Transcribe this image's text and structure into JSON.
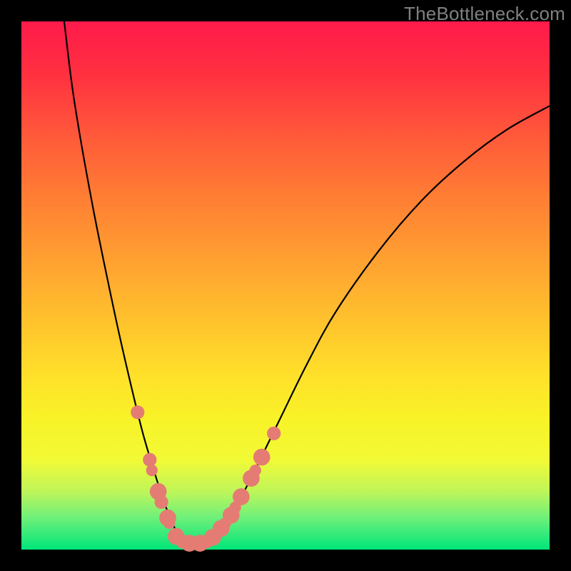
{
  "watermark": "TheBottleneck.com",
  "colors": {
    "frame_background": "#000000",
    "gradient_top": "#ff1a4b",
    "gradient_bottom": "#00e57a",
    "curve_stroke": "#000000",
    "marker_fill": "#e47c74",
    "watermark_color": "#808080"
  },
  "chart_data": {
    "type": "line",
    "title": "",
    "xlabel": "",
    "ylabel": "",
    "xlim": [
      0,
      100
    ],
    "ylim": [
      0,
      100
    ],
    "grid": false,
    "legend": false,
    "series": [
      {
        "name": "curve",
        "x": [
          8.1,
          10,
          13.5,
          17.6,
          20.3,
          23.0,
          25.7,
          27.0,
          28.4,
          29.7,
          32.4,
          35.1,
          37.8,
          40.5,
          43.2,
          48.6,
          54.0,
          59.5,
          67.6,
          75.7,
          83.8,
          91.9,
          100.0
        ],
        "y": [
          100,
          85,
          65.0,
          45.0,
          33.0,
          22.0,
          13.0,
          9.0,
          5.5,
          3.0,
          1.0,
          1.5,
          4.0,
          8.0,
          13.0,
          24.0,
          35.0,
          45.0,
          56.5,
          66.0,
          73.5,
          79.5,
          84.0
        ]
      }
    ],
    "markers": {
      "name": "highlight-markers",
      "points": [
        {
          "x": 22.0,
          "y": 26.0,
          "r": 1.3
        },
        {
          "x": 24.3,
          "y": 17.0,
          "r": 1.3
        },
        {
          "x": 24.7,
          "y": 15.0,
          "r": 1.1
        },
        {
          "x": 25.9,
          "y": 11.0,
          "r": 1.6
        },
        {
          "x": 26.5,
          "y": 9.0,
          "r": 1.3
        },
        {
          "x": 27.7,
          "y": 6.0,
          "r": 1.6
        },
        {
          "x": 28.0,
          "y": 5.0,
          "r": 1.1
        },
        {
          "x": 29.3,
          "y": 2.5,
          "r": 1.6
        },
        {
          "x": 30.5,
          "y": 1.5,
          "r": 1.3
        },
        {
          "x": 31.8,
          "y": 1.2,
          "r": 1.6
        },
        {
          "x": 33.8,
          "y": 1.2,
          "r": 1.6
        },
        {
          "x": 35.0,
          "y": 1.5,
          "r": 1.3
        },
        {
          "x": 36.2,
          "y": 2.3,
          "r": 1.6
        },
        {
          "x": 37.8,
          "y": 4.0,
          "r": 1.6
        },
        {
          "x": 38.6,
          "y": 5.0,
          "r": 1.1
        },
        {
          "x": 39.7,
          "y": 6.5,
          "r": 1.6
        },
        {
          "x": 40.5,
          "y": 8.0,
          "r": 1.1
        },
        {
          "x": 41.6,
          "y": 10.0,
          "r": 1.6
        },
        {
          "x": 43.5,
          "y": 13.5,
          "r": 1.6
        },
        {
          "x": 44.3,
          "y": 15.0,
          "r": 1.1
        },
        {
          "x": 45.5,
          "y": 17.5,
          "r": 1.6
        },
        {
          "x": 47.8,
          "y": 22.0,
          "r": 1.3
        }
      ]
    }
  }
}
